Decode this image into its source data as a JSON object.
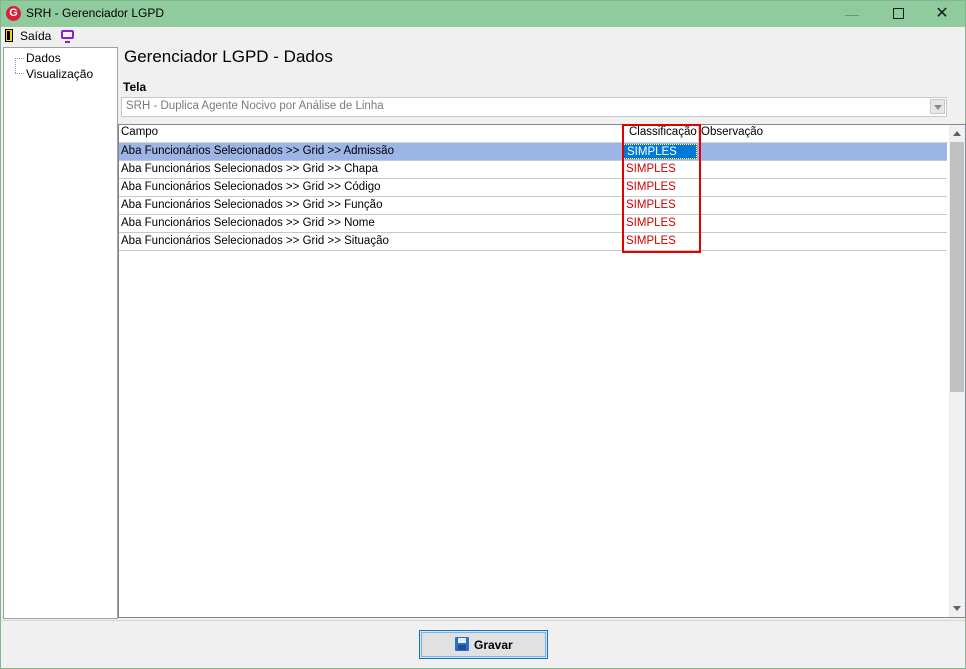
{
  "window": {
    "title": "SRH - Gerenciador LGPD",
    "app_icon_letter": "G",
    "minimize_symbol": "—",
    "close_symbol": "✕"
  },
  "menu": {
    "exit_label": "Saída"
  },
  "tree": {
    "items": [
      "Dados",
      "Visualização"
    ]
  },
  "page": {
    "title": "Gerenciador LGPD - Dados",
    "tela_label": "Tela",
    "tela_value": "SRH - Duplica Agente Nocivo por Análise de Linha"
  },
  "grid": {
    "columns": [
      "Campo",
      "Classificação",
      "Observação"
    ],
    "rows": [
      {
        "campo": "Aba Funcionários Selecionados >> Grid >> Admissão",
        "classificacao": "SIMPLES",
        "observacao": ""
      },
      {
        "campo": "Aba Funcionários Selecionados >> Grid >> Chapa",
        "classificacao": "SIMPLES",
        "observacao": ""
      },
      {
        "campo": "Aba Funcionários Selecionados >> Grid >> Código",
        "classificacao": "SIMPLES",
        "observacao": ""
      },
      {
        "campo": "Aba Funcionários Selecionados >> Grid >> Função",
        "classificacao": "SIMPLES",
        "observacao": ""
      },
      {
        "campo": "Aba Funcionários Selecionados >> Grid >> Nome",
        "classificacao": "SIMPLES",
        "observacao": ""
      },
      {
        "campo": "Aba Funcionários Selecionados >> Grid >> Situação",
        "classificacao": "SIMPLES",
        "observacao": ""
      }
    ],
    "selected_row": 0
  },
  "footer": {
    "save_label": "Gravar"
  },
  "colors": {
    "titlebar": "#8fcb9c",
    "selected_row": "#9db4e6",
    "selected_cell": "#0078d7",
    "classification_text": "#d10000",
    "highlight_box": "#e00000"
  },
  "icons": [
    "app-logo-icon",
    "exit-door-icon",
    "monitor-icon",
    "save-disk-icon"
  ]
}
